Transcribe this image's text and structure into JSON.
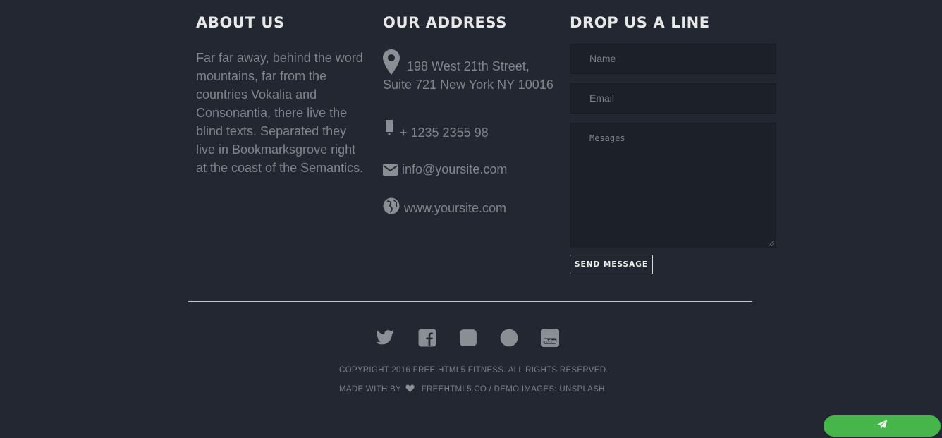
{
  "about": {
    "heading": "ABOUT US",
    "text": "Far far away, behind the word mountains, far from the countries Vokalia and Consonantia, there live the blind texts. Separated they live in Bookmarksgrove right at the coast of the Semantics."
  },
  "address": {
    "heading": "OUR ADDRESS",
    "street_line1": "198 West 21th Street,",
    "street_line2": "Suite 721 New York NY 10016",
    "phone": "+ 1235 2355 98",
    "email": "info@yoursite.com",
    "website": "www.yoursite.com",
    "icons": [
      "map-pin-icon",
      "phone-icon",
      "envelope-icon",
      "globe-icon"
    ]
  },
  "contact": {
    "heading": "DROP US A LINE",
    "name_placeholder": "Name",
    "email_placeholder": "Email",
    "message_placeholder": "Mesages",
    "send_label": "SEND MESSAGE"
  },
  "social": {
    "icons": [
      "twitter-icon",
      "facebook-icon",
      "instagram-icon",
      "dribbble-icon",
      "youtube-icon"
    ]
  },
  "footer": {
    "copyright": "COPYRIGHT 2016 FREE HTML5 FITNESS. ALL RIGHTS RESERVED.",
    "made_with": "MADE WITH BY",
    "made_by_link": "FREEHTML5.CO",
    "separator": "/ DEMO IMAGES:",
    "images_link": "UNSPLASH"
  },
  "colors": {
    "background": "#222731",
    "heading": "#e8e8e8",
    "text": "#80848b",
    "accent": "#46b54a"
  }
}
